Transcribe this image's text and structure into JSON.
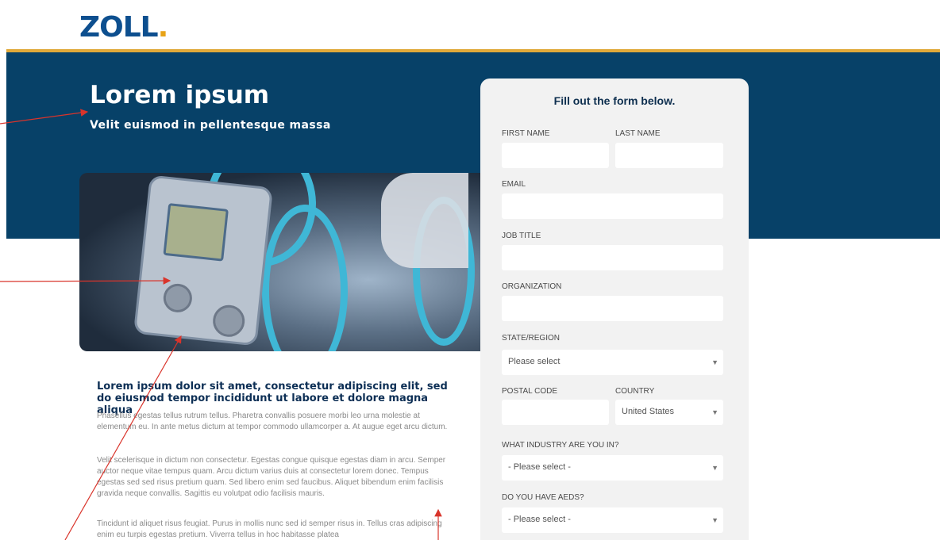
{
  "brand": {
    "logo_text": "ZOLL",
    "logo_dot": ".",
    "accent": "#e0a93a",
    "primary": "#074168"
  },
  "hero": {
    "title": "Lorem ipsum",
    "subtitle": "Velit euismod in pellentesque massa"
  },
  "form": {
    "title": "Fill out the form below.",
    "first_name_label": "FIRST NAME",
    "last_name_label": "LAST NAME",
    "email_label": "EMAIL",
    "job_title_label": "JOB TITLE",
    "organization_label": "ORGANIZATION",
    "state_label": "STATE/REGION",
    "state_value": "Please select",
    "postal_label": "POSTAL CODE",
    "country_label": "COUNTRY",
    "country_value": "United States",
    "industry_label": "WHAT INDUSTRY ARE YOU IN?",
    "industry_value": "- Please select -",
    "aeds_label": "DO YOU HAVE AEDS?",
    "aeds_value": "- Please select -",
    "chevron": "▼"
  },
  "article": {
    "heading": "Lorem ipsum dolor sit amet, consectetur adipiscing elit, sed do eiusmod tempor incididunt ut labore et dolore magna aliqua",
    "p1": "Phasellus egestas tellus rutrum tellus. Pharetra convallis posuere morbi leo urna molestie at elementum eu. In ante metus dictum at tempor commodo ullamcorper a. At augue eget arcu dictum.",
    "p2": "Velit scelerisque in dictum non consectetur. Egestas congue quisque egestas diam in arcu. Semper auctor neque vitae tempus quam. Arcu dictum varius duis at consectetur lorem donec. Tempus egestas sed sed risus pretium quam. Sed libero enim sed faucibus. Aliquet bibendum enim facilisis gravida neque convallis. Sagittis eu volutpat odio facilisis mauris.",
    "p3": "Tincidunt id aliquet risus feugiat. Purus in mollis nunc sed id semper risus in. Tellus cras adipiscing enim eu turpis egestas pretium. Viverra tellus in hoc habitasse platea"
  },
  "annotations": {
    "arrow_color": "#d9342b"
  }
}
